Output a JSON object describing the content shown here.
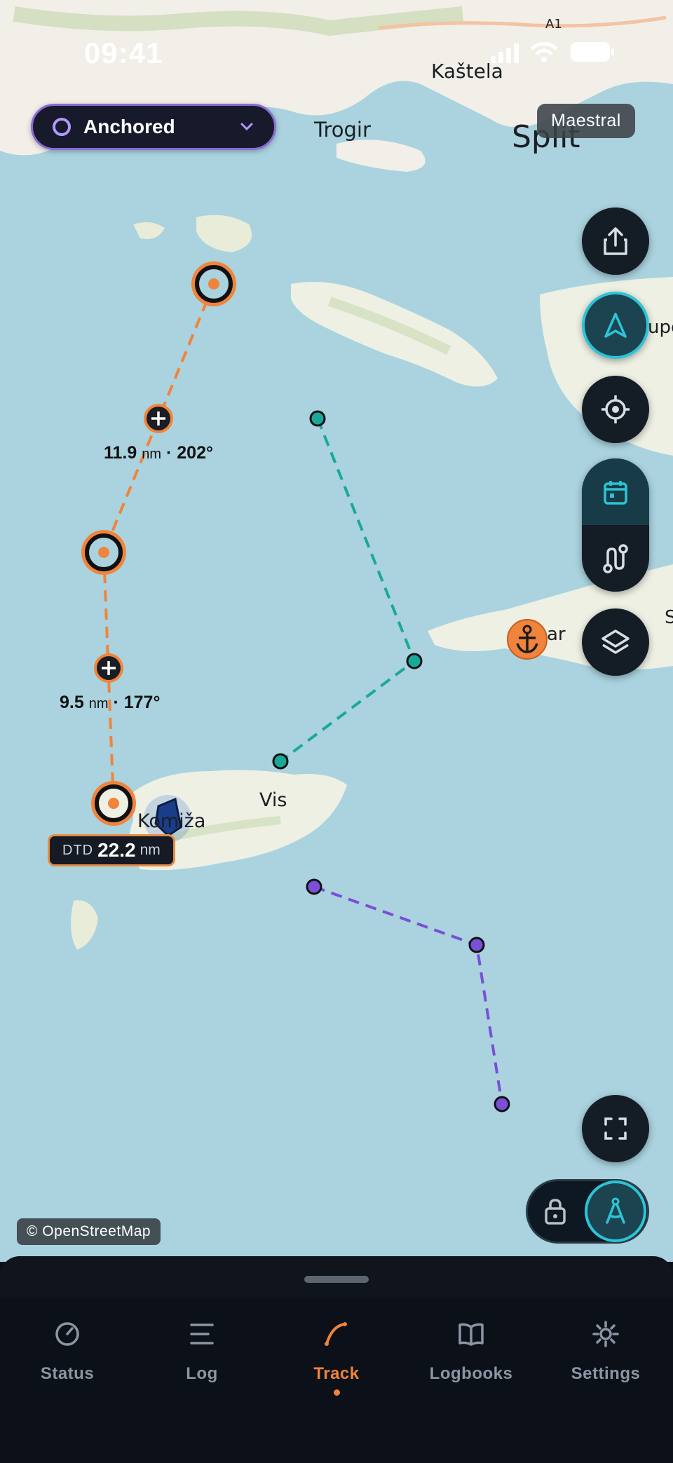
{
  "status_bar": {
    "time": "09:41"
  },
  "mode_selector": {
    "label": "Anchored"
  },
  "wind_badge": {
    "label": "Maestral"
  },
  "map_labels": {
    "kastela": "Kaštela",
    "trogir": "Trogir",
    "split": "Split",
    "supetar_fragment": "upe",
    "hvar_fragment": "ar",
    "s_fragment": "S",
    "vis": "Vis",
    "komiza": "Komiža",
    "road": "A1"
  },
  "route": {
    "leg1": {
      "distance": "11.9",
      "unit": "nm",
      "bearing": "· 202°"
    },
    "leg2": {
      "distance": "9.5",
      "unit": "nm",
      "bearing": "· 177°"
    },
    "dtd": {
      "label": "DTD",
      "value": "22.2",
      "unit": "nm"
    }
  },
  "attribution": "© OpenStreetMap",
  "tabs": [
    {
      "label": "Status",
      "icon": "gauge-icon"
    },
    {
      "label": "Log",
      "icon": "list-icon"
    },
    {
      "label": "Track",
      "icon": "track-curve-icon"
    },
    {
      "label": "Logbooks",
      "icon": "book-icon"
    },
    {
      "label": "Settings",
      "icon": "gear-icon"
    }
  ],
  "colors": {
    "route_orange": "#f0843c",
    "track_teal": "#1aa89a",
    "track_purple": "#7b4fd6",
    "accent_cyan": "#2cc4d6",
    "sea": "#aad3df",
    "land": "#f2efe9"
  }
}
